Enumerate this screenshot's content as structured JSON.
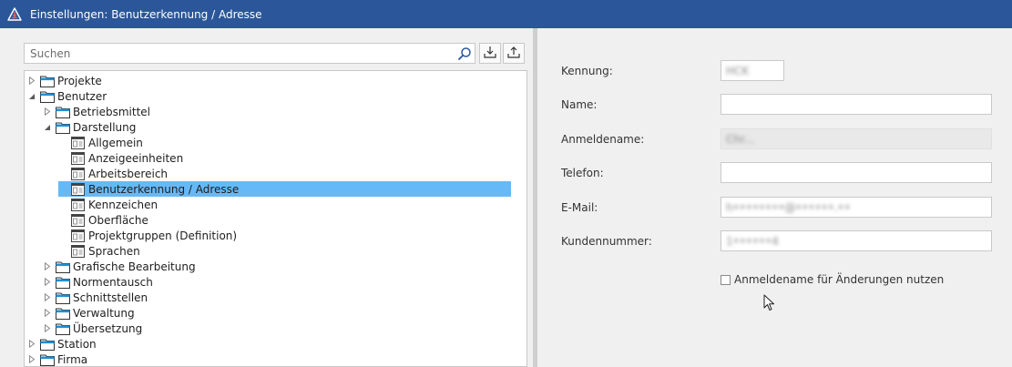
{
  "window": {
    "title": "Einstellungen: Benutzerkennung / Adresse",
    "app_icon": "warning-triangle-icon",
    "accent_color": "#2b579a"
  },
  "search": {
    "placeholder": "Suchen",
    "value": ""
  },
  "toolbar": {
    "import_icon": "download-tray-icon",
    "export_icon": "upload-tray-icon"
  },
  "tree": {
    "items": [
      {
        "label": "Projekte",
        "level": 0,
        "expander": "collapsed",
        "icon": "folder-icon"
      },
      {
        "label": "Benutzer",
        "level": 0,
        "expander": "expanded",
        "icon": "folder-icon"
      },
      {
        "label": "Betriebsmittel",
        "level": 1,
        "expander": "collapsed",
        "icon": "folder-icon"
      },
      {
        "label": "Darstellung",
        "level": 1,
        "expander": "expanded",
        "icon": "folder-icon"
      },
      {
        "label": "Allgemein",
        "level": 2,
        "expander": "none",
        "icon": "settings-page-icon"
      },
      {
        "label": "Anzeigeeinheiten",
        "level": 2,
        "expander": "none",
        "icon": "settings-page-icon"
      },
      {
        "label": "Arbeitsbereich",
        "level": 2,
        "expander": "none",
        "icon": "settings-page-icon"
      },
      {
        "label": "Benutzerkennung / Adresse",
        "level": 2,
        "expander": "none",
        "icon": "settings-page-icon",
        "selected": true
      },
      {
        "label": "Kennzeichen",
        "level": 2,
        "expander": "none",
        "icon": "settings-page-icon"
      },
      {
        "label": "Oberfläche",
        "level": 2,
        "expander": "none",
        "icon": "settings-page-icon"
      },
      {
        "label": "Projektgruppen (Definition)",
        "level": 2,
        "expander": "none",
        "icon": "settings-page-icon"
      },
      {
        "label": "Sprachen",
        "level": 2,
        "expander": "none",
        "icon": "settings-page-icon"
      },
      {
        "label": "Grafische Bearbeitung",
        "level": 1,
        "expander": "collapsed",
        "icon": "folder-icon"
      },
      {
        "label": "Normentausch",
        "level": 1,
        "expander": "collapsed",
        "icon": "folder-icon"
      },
      {
        "label": "Schnittstellen",
        "level": 1,
        "expander": "collapsed",
        "icon": "folder-icon"
      },
      {
        "label": "Verwaltung",
        "level": 1,
        "expander": "collapsed",
        "icon": "folder-icon"
      },
      {
        "label": "Übersetzung",
        "level": 1,
        "expander": "collapsed",
        "icon": "folder-icon"
      },
      {
        "label": "Station",
        "level": 0,
        "expander": "collapsed",
        "icon": "folder-icon"
      },
      {
        "label": "Firma",
        "level": 0,
        "expander": "collapsed",
        "icon": "folder-icon"
      }
    ]
  },
  "form": {
    "kennung": {
      "label": "Kennung:",
      "value": "HCK"
    },
    "name": {
      "label": "Name:",
      "value": ""
    },
    "anmeldename": {
      "label": "Anmeldename:",
      "value": "Chr..."
    },
    "telefon": {
      "label": "Telefon:",
      "value": ""
    },
    "email": {
      "label": "E-Mail:",
      "value": "h••••••••@••••••.••"
    },
    "kundennummer": {
      "label": "Kundennummer:",
      "value": "1••••••4"
    },
    "checkbox": {
      "label": "Anmeldename für Änderungen nutzen",
      "checked": false
    }
  }
}
